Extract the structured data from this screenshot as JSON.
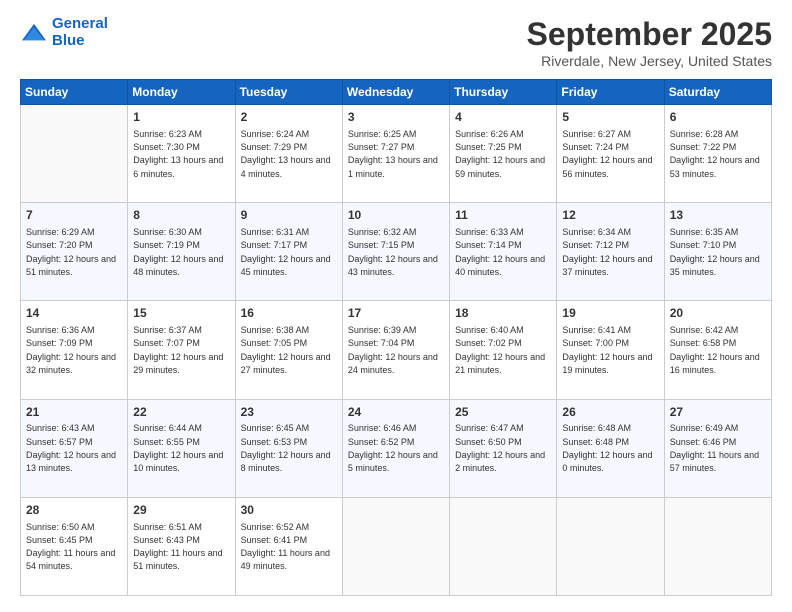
{
  "logo": {
    "line1": "General",
    "line2": "Blue"
  },
  "title": "September 2025",
  "location": "Riverdale, New Jersey, United States",
  "weekdays": [
    "Sunday",
    "Monday",
    "Tuesday",
    "Wednesday",
    "Thursday",
    "Friday",
    "Saturday"
  ],
  "weeks": [
    [
      {
        "day": "",
        "empty": true
      },
      {
        "day": "1",
        "sunrise": "6:23 AM",
        "sunset": "7:30 PM",
        "daylight": "13 hours and 6 minutes."
      },
      {
        "day": "2",
        "sunrise": "6:24 AM",
        "sunset": "7:29 PM",
        "daylight": "13 hours and 4 minutes."
      },
      {
        "day": "3",
        "sunrise": "6:25 AM",
        "sunset": "7:27 PM",
        "daylight": "13 hours and 1 minute."
      },
      {
        "day": "4",
        "sunrise": "6:26 AM",
        "sunset": "7:25 PM",
        "daylight": "12 hours and 59 minutes."
      },
      {
        "day": "5",
        "sunrise": "6:27 AM",
        "sunset": "7:24 PM",
        "daylight": "12 hours and 56 minutes."
      },
      {
        "day": "6",
        "sunrise": "6:28 AM",
        "sunset": "7:22 PM",
        "daylight": "12 hours and 53 minutes."
      }
    ],
    [
      {
        "day": "7",
        "sunrise": "6:29 AM",
        "sunset": "7:20 PM",
        "daylight": "12 hours and 51 minutes."
      },
      {
        "day": "8",
        "sunrise": "6:30 AM",
        "sunset": "7:19 PM",
        "daylight": "12 hours and 48 minutes."
      },
      {
        "day": "9",
        "sunrise": "6:31 AM",
        "sunset": "7:17 PM",
        "daylight": "12 hours and 45 minutes."
      },
      {
        "day": "10",
        "sunrise": "6:32 AM",
        "sunset": "7:15 PM",
        "daylight": "12 hours and 43 minutes."
      },
      {
        "day": "11",
        "sunrise": "6:33 AM",
        "sunset": "7:14 PM",
        "daylight": "12 hours and 40 minutes."
      },
      {
        "day": "12",
        "sunrise": "6:34 AM",
        "sunset": "7:12 PM",
        "daylight": "12 hours and 37 minutes."
      },
      {
        "day": "13",
        "sunrise": "6:35 AM",
        "sunset": "7:10 PM",
        "daylight": "12 hours and 35 minutes."
      }
    ],
    [
      {
        "day": "14",
        "sunrise": "6:36 AM",
        "sunset": "7:09 PM",
        "daylight": "12 hours and 32 minutes."
      },
      {
        "day": "15",
        "sunrise": "6:37 AM",
        "sunset": "7:07 PM",
        "daylight": "12 hours and 29 minutes."
      },
      {
        "day": "16",
        "sunrise": "6:38 AM",
        "sunset": "7:05 PM",
        "daylight": "12 hours and 27 minutes."
      },
      {
        "day": "17",
        "sunrise": "6:39 AM",
        "sunset": "7:04 PM",
        "daylight": "12 hours and 24 minutes."
      },
      {
        "day": "18",
        "sunrise": "6:40 AM",
        "sunset": "7:02 PM",
        "daylight": "12 hours and 21 minutes."
      },
      {
        "day": "19",
        "sunrise": "6:41 AM",
        "sunset": "7:00 PM",
        "daylight": "12 hours and 19 minutes."
      },
      {
        "day": "20",
        "sunrise": "6:42 AM",
        "sunset": "6:58 PM",
        "daylight": "12 hours and 16 minutes."
      }
    ],
    [
      {
        "day": "21",
        "sunrise": "6:43 AM",
        "sunset": "6:57 PM",
        "daylight": "12 hours and 13 minutes."
      },
      {
        "day": "22",
        "sunrise": "6:44 AM",
        "sunset": "6:55 PM",
        "daylight": "12 hours and 10 minutes."
      },
      {
        "day": "23",
        "sunrise": "6:45 AM",
        "sunset": "6:53 PM",
        "daylight": "12 hours and 8 minutes."
      },
      {
        "day": "24",
        "sunrise": "6:46 AM",
        "sunset": "6:52 PM",
        "daylight": "12 hours and 5 minutes."
      },
      {
        "day": "25",
        "sunrise": "6:47 AM",
        "sunset": "6:50 PM",
        "daylight": "12 hours and 2 minutes."
      },
      {
        "day": "26",
        "sunrise": "6:48 AM",
        "sunset": "6:48 PM",
        "daylight": "12 hours and 0 minutes."
      },
      {
        "day": "27",
        "sunrise": "6:49 AM",
        "sunset": "6:46 PM",
        "daylight": "11 hours and 57 minutes."
      }
    ],
    [
      {
        "day": "28",
        "sunrise": "6:50 AM",
        "sunset": "6:45 PM",
        "daylight": "11 hours and 54 minutes."
      },
      {
        "day": "29",
        "sunrise": "6:51 AM",
        "sunset": "6:43 PM",
        "daylight": "11 hours and 51 minutes."
      },
      {
        "day": "30",
        "sunrise": "6:52 AM",
        "sunset": "6:41 PM",
        "daylight": "11 hours and 49 minutes."
      },
      {
        "day": "",
        "empty": true
      },
      {
        "day": "",
        "empty": true
      },
      {
        "day": "",
        "empty": true
      },
      {
        "day": "",
        "empty": true
      }
    ]
  ]
}
